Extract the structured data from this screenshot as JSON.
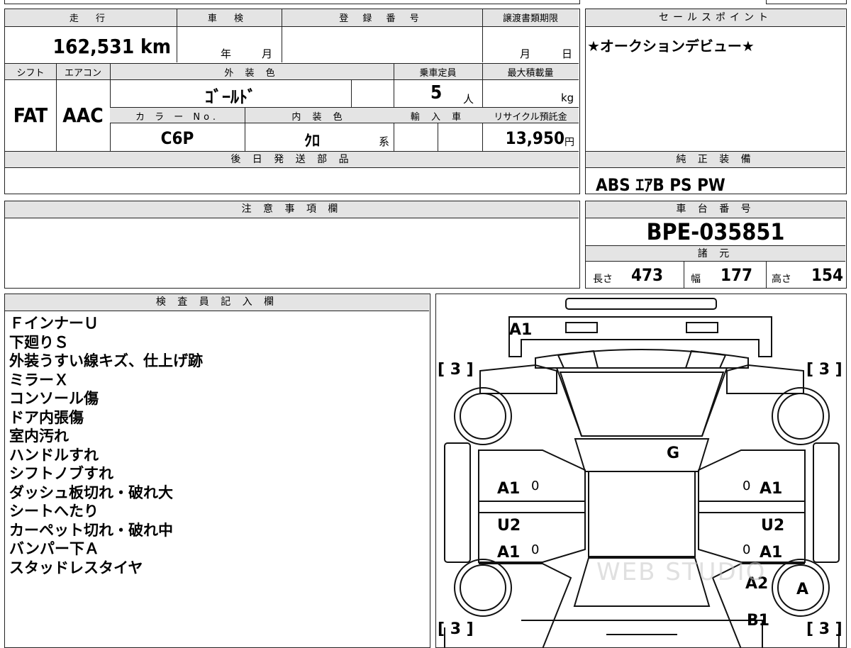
{
  "top": {
    "mileage_header": "走 行",
    "shaken_header": "車 検",
    "reg_header": "登 録 番 号",
    "transfer_header": "譲渡書類期限",
    "sales_header": "セールスポイント",
    "mileage": "162,531 km",
    "shaken_year": "年",
    "shaken_month": "月",
    "transfer_month": "月",
    "transfer_day": "日",
    "sales_point": "★オークションデビュー★"
  },
  "spec": {
    "shift_header": "シフト",
    "aircon_header": "エアコン",
    "exterior_header": "外 装 色",
    "capacity_header": "乗車定員",
    "maxload_header": "最大積載量",
    "shift": "FAT",
    "aircon": "AAC",
    "exterior_color": "ｺﾞｰﾙﾄﾞ",
    "capacity": "5",
    "capacity_unit": "人",
    "maxload_unit": "kg",
    "color_no_header": "カ ラ ー No.",
    "interior_header": "内 装 色",
    "import_header": "輸 入 車",
    "recycle_header": "リサイクル預託金",
    "color_no": "C6P",
    "interior_color": "ｸﾛ",
    "interior_suffix": "系",
    "recycle_fee": "13,950",
    "recycle_unit": "円"
  },
  "later_parts": {
    "header": "後 日 発 送 部 品"
  },
  "genuine": {
    "header": "純 正 装 備",
    "items": "ABS ｴｱB PS PW"
  },
  "caution": {
    "header": "注 意 事 項 欄"
  },
  "chassis": {
    "header": "車 台 番 号",
    "number": "BPE-035851",
    "dims_header": "諸 元",
    "length_label": "長さ",
    "length": "473",
    "width_label": "幅",
    "width": "177",
    "height_label": "高さ",
    "height": "154"
  },
  "inspector": {
    "header": "検 査 員 記 入 欄",
    "notes": [
      "ＦインナーＵ",
      "下廻りＳ",
      "外装うすい線キズ、仕上げ跡",
      "ミラーＸ",
      "コンソール傷",
      "ドア内張傷",
      "室内汚れ",
      "ハンドルすれ",
      "シフトノブすれ",
      "ダッシュ板切れ・破れ大",
      "シートへたり",
      "カーペット切れ・破れ中",
      "バンパー下Ａ",
      "スタッドレスタイヤ"
    ]
  },
  "diagram": {
    "front_bumper": "A1",
    "tire_fl": "[ 3 ]",
    "tire_fr": "[ 3 ]",
    "tire_rl": "[ 3 ]",
    "tire_rr": "[ 3 ]",
    "windshield": "G",
    "left_front_door": "A1",
    "left_front_door_zero": "0",
    "left_rear_upper": "U2",
    "left_rear_door": "A1",
    "left_rear_door_zero": "0",
    "right_front_door": "A1",
    "right_front_door_zero": "0",
    "right_rear_upper": "U2",
    "right_rear_door": "A1",
    "right_rear_door_zero": "0",
    "right_rear_fender": "A2",
    "right_rear_wheel": "A",
    "rear_right": "B1",
    "watermark": "WEB STUDIO"
  }
}
